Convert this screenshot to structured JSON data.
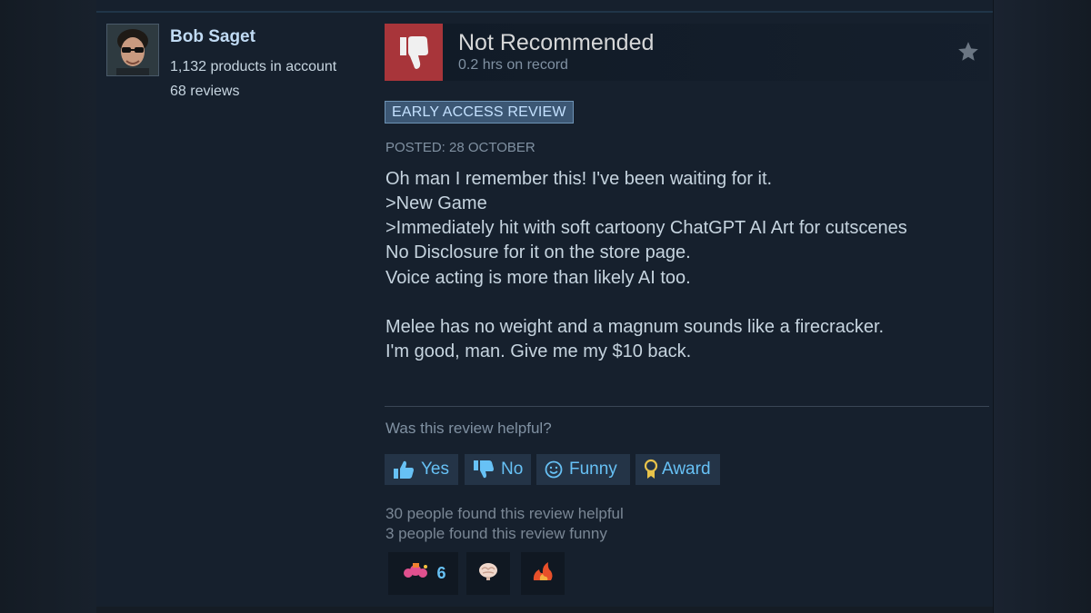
{
  "author": {
    "name": "Bob Saget",
    "products": "1,132 products in account",
    "reviews": "68 reviews"
  },
  "verdict": {
    "title": "Not Recommended",
    "hours": "0.2 hrs on record",
    "icon": "thumbs-down-icon",
    "color": "#a8353a"
  },
  "badge": "EARLY ACCESS REVIEW",
  "posted": "POSTED: 28 OCTOBER",
  "review_lines": [
    "Oh man I remember this! I've been waiting for it.",
    ">New Game",
    ">Immediately hit with soft cartoony ChatGPT AI Art for cutscenes",
    "No Disclosure for it on the store page.",
    "Voice acting is more than likely AI too.",
    "",
    "Melee has no weight and a magnum sounds like a firecracker.",
    "I'm good, man. Give me my $10 back."
  ],
  "helpful": {
    "question": "Was this review helpful?",
    "buttons": {
      "yes": "Yes",
      "no": "No",
      "funny": "Funny",
      "award": "Award"
    },
    "helpful_count_text": "30 people found this review helpful",
    "funny_count_text": "3 people found this review funny"
  },
  "awards": [
    {
      "icon": "wholesome-award-icon",
      "count": "6"
    },
    {
      "icon": "brain-award-icon",
      "count": ""
    },
    {
      "icon": "fire-award-icon",
      "count": ""
    }
  ],
  "colors": {
    "accent": "#67c1f5",
    "negative": "#a8353a",
    "badge_bg": "#3c5774"
  }
}
